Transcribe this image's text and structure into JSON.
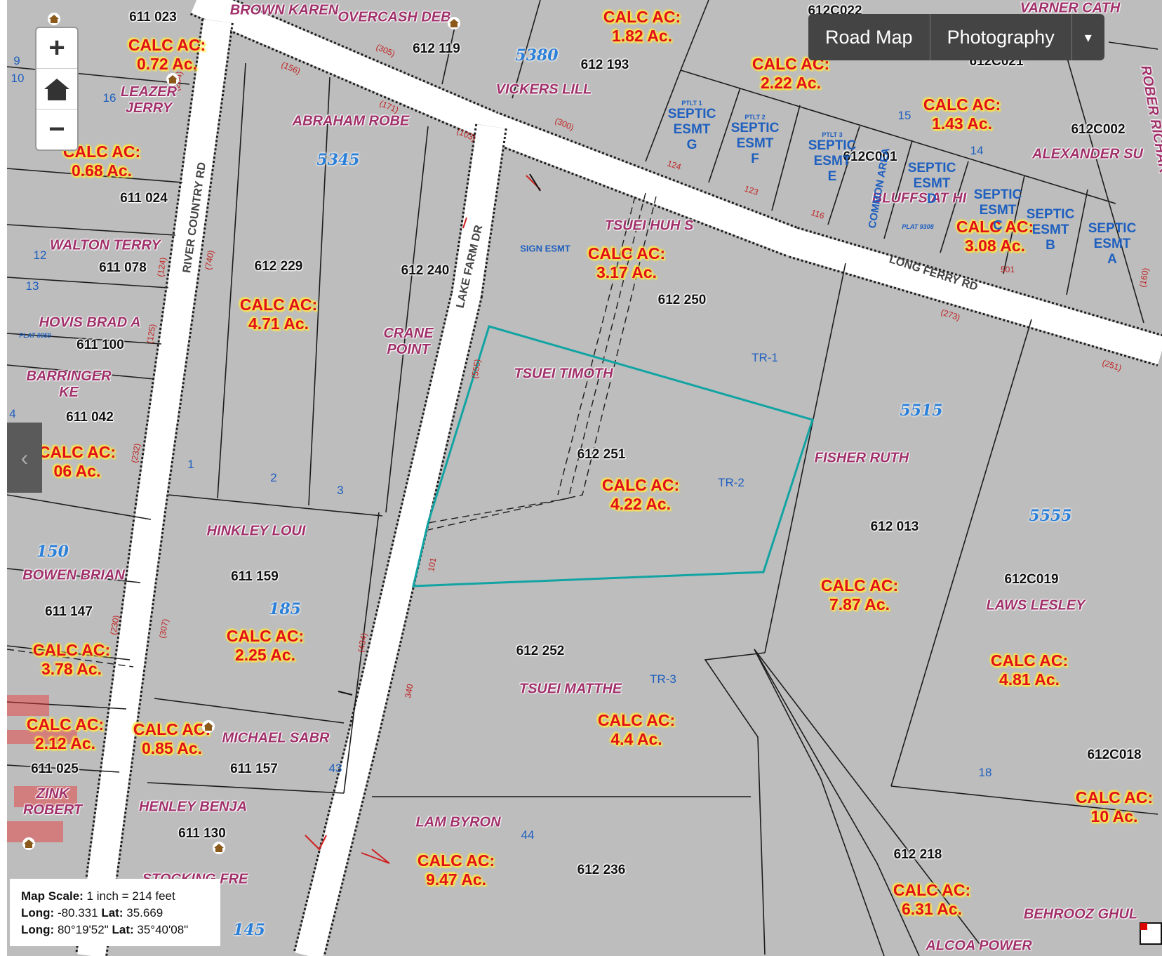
{
  "controls": {
    "zoom_in": "+",
    "home": "home",
    "zoom_out": "−",
    "basemap_road": "Road Map",
    "basemap_photo": "Photography",
    "basemap_dropdown": "▾",
    "side_toggle": "‹"
  },
  "scale": {
    "scale_label": "Map Scale:",
    "scale_value": "1 inch = 214 feet",
    "long_label": "Long:",
    "long_dec": "-80.331",
    "lat_label": "Lat:",
    "lat_dec": "35.669",
    "long_dms": "80°19'52\"",
    "lat_dms": "35°40'08\""
  },
  "roads": [
    "LONG FERRY RD",
    "LAKE FARM DR",
    "RIVER COUNTRY RD"
  ],
  "parcels": [
    "611 023",
    "612 119",
    "612 193",
    "612C022",
    "612C021",
    "612C002",
    "612C001",
    "611 024",
    "611 078",
    "612 229",
    "612 240",
    "612 250",
    "611 100",
    "611 042",
    "612 251",
    "612 013",
    "611 159",
    "611 147",
    "612C019",
    "612 252",
    "611 025",
    "611 157",
    "612C018",
    "611 130",
    "612 218",
    "612 236"
  ],
  "owners": [
    "BROWN KAREN",
    "OVERCASH DEB",
    "VARNER CATH",
    "VICKERS LILL",
    "LEAZER JERRY",
    "ABRAHAM ROBE",
    "ALEXANDER SU",
    "BLUFFS AT HI",
    "TSUEI HUH S",
    "WALTON TERRY",
    "HOVIS BRAD A",
    "BARRINGER KE",
    "CRANE POINT",
    "TSUEI TIMOTH",
    "FISHER RUTH",
    "HINKLEY LOUI",
    "BOWEN BRIAN",
    "LAWS LESLEY",
    "TSUEI MATTHE",
    "MICHAEL SABR",
    "ZINK ROBERT",
    "HENLEY BENJA",
    "STOCKING FRE",
    "LAM BYRON",
    "BEHROOZ GHUL",
    "ALCOA POWER",
    "ROBER RICHAR"
  ],
  "calc": {
    "prefix": "CALC AC:",
    "values": [
      "1.82 Ac.",
      "0.72 Ac.",
      "2.22 Ac.",
      "1.43 Ac.",
      "0.68 Ac.",
      "3.08 Ac.",
      "3.17 Ac.",
      "4.71 Ac.",
      "06 Ac.",
      "4.22 Ac.",
      "7.87 Ac.",
      "2.25 Ac.",
      "3.78 Ac.",
      "4.81 Ac.",
      "4.4 Ac.",
      "2.12 Ac.",
      "0.85 Ac.",
      "10 Ac.",
      "9.47 Ac.",
      "6.31 Ac."
    ]
  },
  "address_numbers": [
    "5380",
    "5345",
    "5515",
    "5555",
    "150",
    "185",
    "145"
  ],
  "tracts": [
    "TR-1",
    "TR-2",
    "TR-3"
  ],
  "lot_numbers": [
    "9",
    "16",
    "10",
    "15",
    "14",
    "12",
    "13",
    "4",
    "1",
    "2",
    "3",
    "43",
    "44",
    "18"
  ],
  "easements": {
    "sign": "SIGN ESMT",
    "septic": "SEPTIC ESMT",
    "letters": [
      "G",
      "F",
      "E",
      "D",
      "C",
      "B",
      "A"
    ],
    "common_area": "COMMON AREA",
    "ptlt": [
      "PTLT 1",
      "PTLT 2",
      "PTLT 3"
    ],
    "plat": [
      "PLAT 8059",
      "PLAT 9308"
    ]
  },
  "colors": {
    "map_bg": "#bdbdbd",
    "road_fill": "#ffffff",
    "parcel_line": "#1c1c1c",
    "highlight": "#12a3a3",
    "owner": "#a0306a",
    "calc_text": "#e0101a",
    "calc_halo": "#ffe84a"
  }
}
